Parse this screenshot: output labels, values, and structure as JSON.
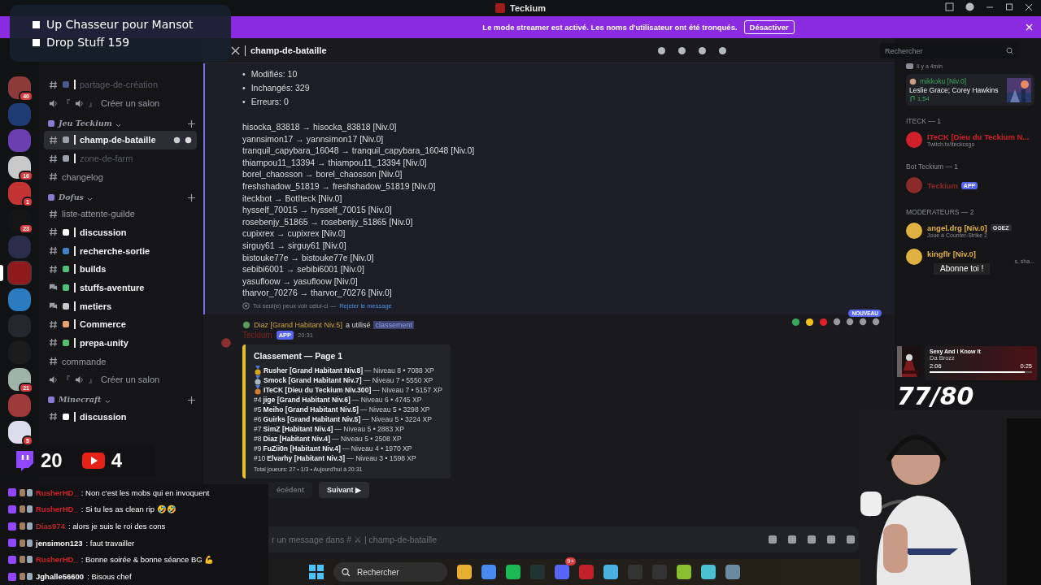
{
  "window": {
    "title": "Teckium"
  },
  "streamer_banner": {
    "text": "Le mode streamer est activé. Les noms d'utilisateur ont été tronqués.",
    "button": "Désactiver"
  },
  "servers": [
    {
      "color": "#8c3a3a",
      "badge": "40",
      "selected": false
    },
    {
      "color": "#1f3b73",
      "selected": false
    },
    {
      "color": "#6b3fb0",
      "selected": false
    },
    {
      "color": "#c9c9c9",
      "badge": "16",
      "selected": false
    },
    {
      "color": "#c23333",
      "badge": "1",
      "selected": false
    },
    {
      "color": "#151515",
      "badge": "23",
      "selected": false
    },
    {
      "color": "#2b2d4a",
      "selected": false
    },
    {
      "color": "#8e1b1b",
      "selected": true
    },
    {
      "color": "#2b7bbf",
      "selected": false
    },
    {
      "color": "#26262e",
      "selected": false
    },
    {
      "color": "#1b1b1b",
      "selected": false
    },
    {
      "color": "#9fb3a8",
      "badge": "21",
      "selected": false
    },
    {
      "color": "#a03a3a",
      "selected": false
    },
    {
      "color": "#dcdcea",
      "badge": "5",
      "selected": false
    }
  ],
  "channels": [
    {
      "kind": "text",
      "name": "partage-de-création",
      "color": "#4a5a8a",
      "muted": true,
      "unread": false,
      "selected": false
    },
    {
      "kind": "voice",
      "prefix": "『",
      "suffix": "』",
      "name": "Créer un salon",
      "muted": false,
      "unread": false,
      "selected": false
    },
    {
      "kind": "category",
      "name": "Jeu Teckium"
    },
    {
      "kind": "text",
      "name": "champ-de-bataille",
      "color": "#9aa0aa",
      "muted": false,
      "unread": false,
      "selected": true
    },
    {
      "kind": "text",
      "name": "zone-de-farm",
      "color": "#9aa0aa",
      "muted": true,
      "unread": false,
      "selected": false
    },
    {
      "kind": "text",
      "name": "changelog",
      "muted": false,
      "unread": false,
      "selected": false
    },
    {
      "kind": "category",
      "name": "Dofus"
    },
    {
      "kind": "text",
      "name": "liste-attente-guilde",
      "muted": false,
      "unread": false,
      "selected": false
    },
    {
      "kind": "text",
      "name": "discussion",
      "color": "#ffffff",
      "muted": false,
      "unread": true,
      "selected": false
    },
    {
      "kind": "text",
      "name": "recherche-sortie",
      "color": "#3b82c4",
      "muted": false,
      "unread": true,
      "selected": false
    },
    {
      "kind": "text",
      "name": "builds",
      "color": "#4ec07a",
      "muted": false,
      "unread": true,
      "selected": false
    },
    {
      "kind": "forum",
      "name": "stuffs-aventure",
      "color": "#4ec07a",
      "muted": false,
      "unread": true,
      "selected": false
    },
    {
      "kind": "forum",
      "name": "metiers",
      "color": "#c8c8c8",
      "muted": false,
      "unread": true,
      "selected": false
    },
    {
      "kind": "text",
      "name": "Commerce",
      "color": "#e8a070",
      "muted": false,
      "unread": true,
      "selected": false
    },
    {
      "kind": "text",
      "name": "prepa-unity",
      "color": "#55c070",
      "muted": false,
      "unread": true,
      "selected": false
    },
    {
      "kind": "text",
      "name": "commande",
      "muted": false,
      "unread": false,
      "selected": false
    },
    {
      "kind": "voice",
      "prefix": "『",
      "suffix": "』",
      "name": "Créer un salon",
      "muted": false,
      "unread": false,
      "selected": false
    },
    {
      "kind": "category",
      "name": "Minecraft"
    },
    {
      "kind": "text",
      "name": "discussion",
      "color": "#ffffff",
      "muted": false,
      "unread": true,
      "selected": false
    }
  ],
  "channel_header": {
    "name": "champ-de-bataille",
    "search_placeholder": "Rechercher"
  },
  "system_message": {
    "bullet_mark": "•",
    "bullets": [
      "Modifiés: 10",
      "Inchangés: 329",
      "Erreurs: 0"
    ],
    "lines": [
      "hisocka_83818 → hisocka_83818 [Niv.0]",
      "yannsimon17 → yannsimon17 [Niv.0]",
      "tranquil_capybara_16048 → tranquil_capybara_16048 [Niv.0]",
      "thiampou11_13394 → thiampou11_13394 [Niv.0]",
      "borel_chaosson → borel_chaosson [Niv.0]",
      "freshshadow_51819 → freshshadow_51819 [Niv.0]",
      "iteckbot → BotIteck [Niv.0]",
      "hysself_70015 → hysself_70015 [Niv.0]",
      "rosebenjy_51865 → rosebenjy_51865 [Niv.0]",
      "cupixrex → cupixrex [Niv.0]",
      "sirguy61 → sirguy61 [Niv.0]",
      "bistouke77e → bistouke77e [Niv.0]",
      "sebibi6001 → sebibi6001 [Niv.0]",
      "yasufloow → yasufloow [Niv.0]",
      "tharvor_70276 → tharvor_70276 [Niv.0]"
    ],
    "note": "Toi seul(e) peux voir celui-ci —",
    "dismiss_link": "Rejeter le message"
  },
  "new_pill": "NOUVEAU",
  "bot_message": {
    "reply_user": "Diaz [Grand Habitant Niv.5]",
    "reply_action": "a utilisé",
    "reply_command": "classement",
    "author": "Teckium",
    "tag": "APP",
    "time": "20:31",
    "embed": {
      "title": "Classement — Page 1",
      "rows": [
        {
          "kind": "medal",
          "color": "#d9a520",
          "name": "Rusher [Grand Habitant Niv.8]",
          "detail": "— Niveau 8 • 7088 XP"
        },
        {
          "kind": "medal",
          "color": "#a9b6c6",
          "name": "Smock [Grand Habitant Niv.7]",
          "detail": "— Niveau 7 • 5550 XP"
        },
        {
          "kind": "medal",
          "color": "#d07a32",
          "name": "ITeCK [Dieu du Teckium Niv.300]",
          "detail": "— Niveau 7 • 5157 XP"
        },
        {
          "kind": "rank",
          "rank": "#4",
          "name": "jige [Grand Habitant Niv.6]",
          "detail": "— Niveau 6 • 4745 XP"
        },
        {
          "kind": "rank",
          "rank": "#5",
          "name": "Meiho [Grand Habitant Niv.5]",
          "detail": "— Niveau 5 • 3298 XP"
        },
        {
          "kind": "rank",
          "rank": "#6",
          "name": "Guirks [Grand Habitant Niv.5]",
          "detail": "— Niveau 5 • 3224 XP"
        },
        {
          "kind": "rank",
          "rank": "#7",
          "name": "SimZ [Habitant Niv.4]",
          "detail": "— Niveau 5 • 2883 XP"
        },
        {
          "kind": "rank",
          "rank": "#8",
          "name": "Diaz [Habitant Niv.4]",
          "detail": "— Niveau 5 • 2508 XP"
        },
        {
          "kind": "rank",
          "rank": "#9",
          "name": "FuZii0n [Habitant Niv.4]",
          "detail": "— Niveau 4 • 1970 XP"
        },
        {
          "kind": "rank",
          "rank": "#10",
          "name": "Elvarhy [Habitant Niv.3]",
          "detail": "— Niveau 3 • 1598 XP"
        }
      ],
      "footer": "Total joueurs: 27 • 1/3 • Aujourd'hui à 20:31"
    },
    "buttons": [
      {
        "label": "écédent",
        "disabled": true
      },
      {
        "label": "Suivant ▶",
        "disabled": false
      }
    ]
  },
  "composer": {
    "placeholder": "r un message dans # ⚔ | champ-de-bataille"
  },
  "members": {
    "activity_time": "Il y a 4min",
    "listening": {
      "user": "mikkoku [Niv.0]",
      "track": "Leslie Grace; Corey Hawkins",
      "time": "1:54"
    },
    "groups": [
      {
        "title": "ITECK — 1",
        "members": [
          {
            "name": "ITeCK [Dieu du Teckium N...",
            "color": "#d0202a",
            "status": "Twitch.tv/iteckcsgo"
          }
        ]
      },
      {
        "title": "Bot Teckium — 1",
        "members": [
          {
            "name": "Teckium",
            "color": "#8a2a2a",
            "tag": "APP"
          }
        ]
      },
      {
        "title": "MODERATEURS — 2",
        "members": [
          {
            "name": "angel.drg [Niv.0]",
            "color": "#e0b040",
            "tag": "GGEZ",
            "status": "Joue à Counter-Strike 2"
          },
          {
            "name": "kingflr [Niv.0]",
            "color": "#e0b040",
            "status": "s, sha..."
          }
        ]
      }
    ]
  },
  "taskbar": {
    "search": "Rechercher",
    "discord_badge": "9+"
  },
  "overlay_tasks": [
    {
      "text": "Up Chasseur pour Mansot",
      "checked": false
    },
    {
      "text": "Drop Stuff 159",
      "checked": false
    }
  ],
  "overlay_counts": {
    "twitch": "20",
    "youtube": "4"
  },
  "overlay_chat": [
    {
      "user": "RusherHD_",
      "color": "#d0202a",
      "text": ": Non c'est les mobs qui en invoquent"
    },
    {
      "user": "RusherHD_",
      "color": "#d0202a",
      "text": ": Si tu les as clean rip 🤣🤣"
    },
    {
      "user": "Dias974",
      "color": "#b02a2a",
      "text": ": alors je suis le roi des cons"
    },
    {
      "user": "jensimon123",
      "color": "#ffffff",
      "text": ": faut travailler"
    },
    {
      "user": "RusherHD_",
      "color": "#d0202a",
      "text": ": Bonne soirée & bonne séance BG 💪"
    },
    {
      "user": "Jghalle56600",
      "color": "#ffffff",
      "text": ": Bisous chef"
    }
  ],
  "overlay_subscribe": "Abonne toi !",
  "overlay_music": {
    "title": "Sexy And I Know It",
    "artist": "Da Brozz",
    "elapsed": "2:06",
    "remaining": "0:25",
    "level": 0.93
  },
  "overlay_goal": "77/80"
}
